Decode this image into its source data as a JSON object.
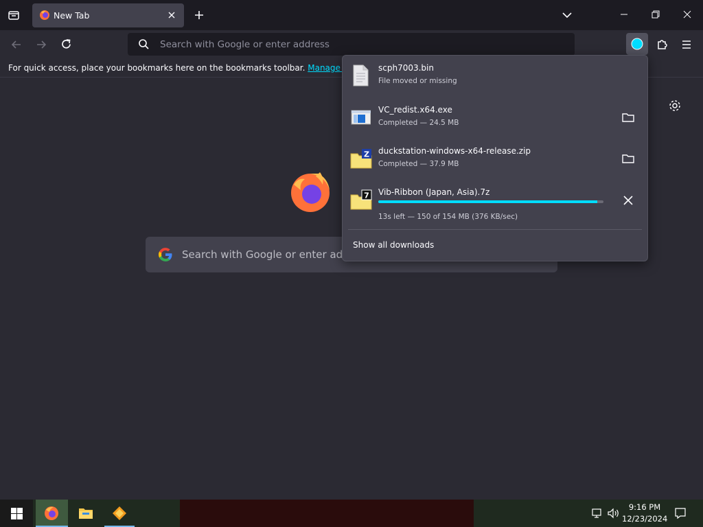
{
  "browser": {
    "tab": {
      "title": "New Tab"
    },
    "urlbar": {
      "placeholder": "Search with Google or enter address"
    },
    "bookmarks_bar": {
      "message": "For quick access, place your bookmarks here on the bookmarks toolbar.",
      "link": "Manage bookmarks"
    }
  },
  "newtab": {
    "search_placeholder": "Search with Google or enter address"
  },
  "downloads": {
    "items": [
      {
        "name": "scph7003.bin",
        "status": "File moved or missing",
        "icon": "file-icon"
      },
      {
        "name": "VC_redist.x64.exe",
        "status": "Completed — 24.5 MB",
        "icon": "exe-icon",
        "action": "folder-icon"
      },
      {
        "name": "duckstation-windows-x64-release.zip",
        "status": "Completed — 37.9 MB",
        "icon": "zip-icon",
        "action": "folder-icon"
      },
      {
        "name": "Vib-Ribbon (Japan, Asia).7z",
        "status": "13s left — 150 of 154 MB (376 KB/sec)",
        "icon": "7z-icon",
        "action": "cancel-icon",
        "progress": 0.974
      }
    ],
    "show_all": "Show all downloads"
  },
  "taskbar": {
    "time": "9:16 PM",
    "date": "12/23/2024"
  },
  "colors": {
    "accent": "#00ddff",
    "toolbar": "#2b2a33",
    "tabstrip": "#1c1b22",
    "panel": "#42414d"
  }
}
